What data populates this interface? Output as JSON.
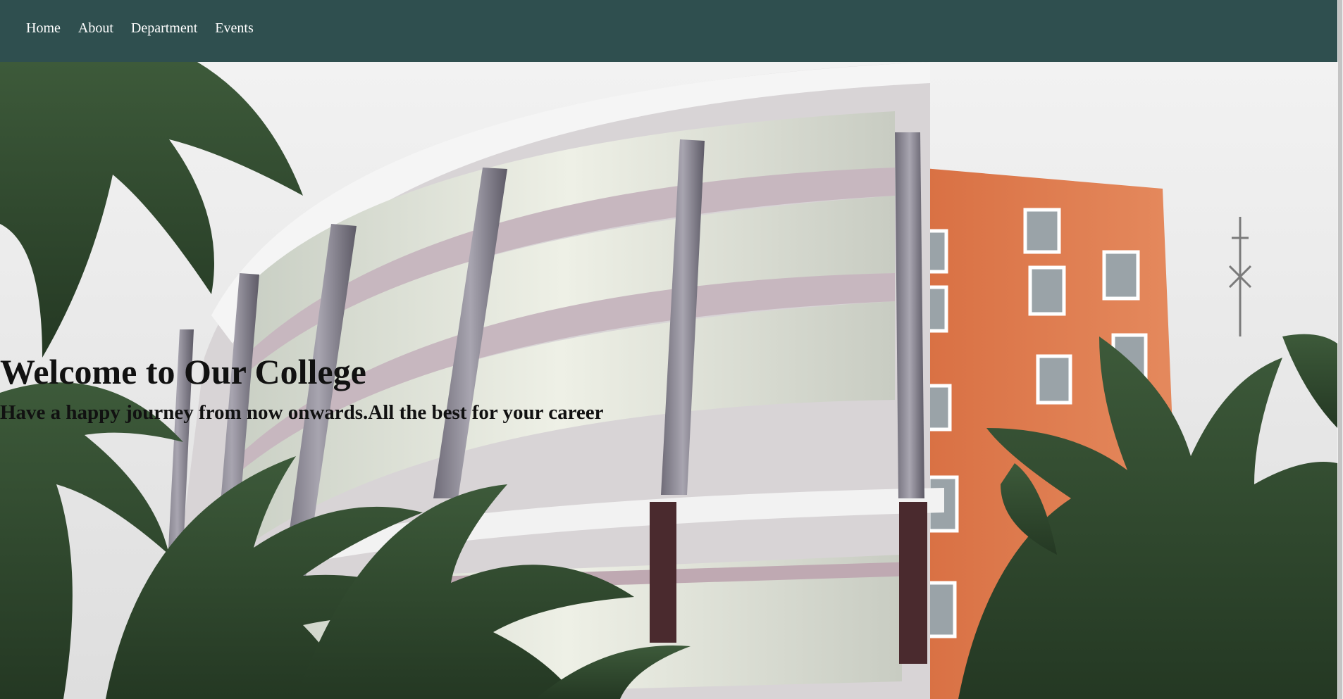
{
  "nav": {
    "items": [
      {
        "label": "Home"
      },
      {
        "label": "About"
      },
      {
        "label": "Department"
      },
      {
        "label": "Events"
      }
    ]
  },
  "hero": {
    "title": "Welcome to Our College",
    "subtitle": "Have a happy journey from now onwards.All the best for your career",
    "image": "college-building-photo"
  },
  "colors": {
    "navbar_bg": "#2f4f4f",
    "nav_text": "#ffffff",
    "hero_text": "#111111"
  }
}
